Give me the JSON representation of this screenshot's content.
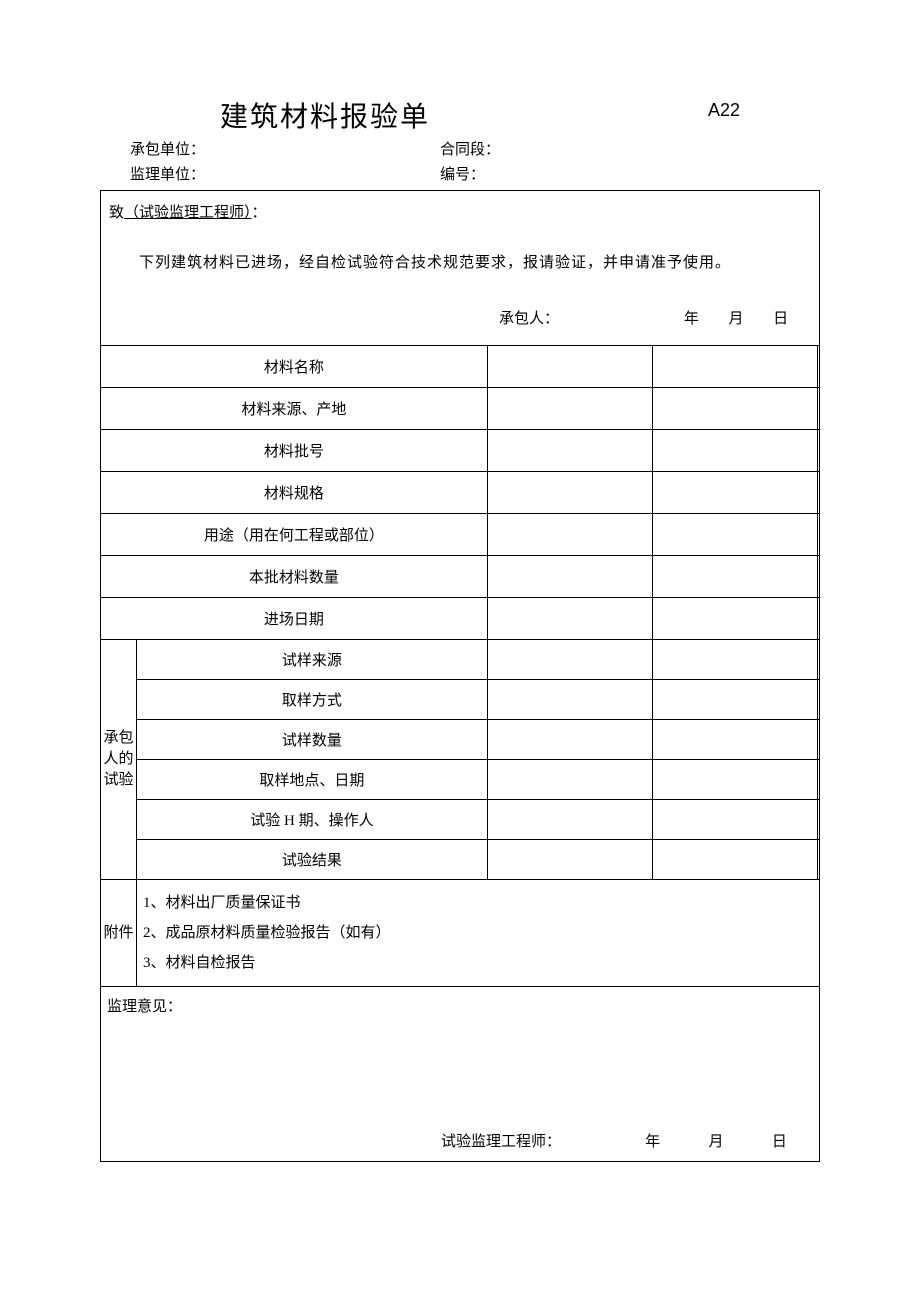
{
  "code": "A22",
  "title": "建筑材料报验单",
  "meta": {
    "contractor_label": "承包单位：",
    "contract_section_label": "合同段：",
    "supervisor_label": "监理单位：",
    "number_label": "编号："
  },
  "top": {
    "to_prefix": "致",
    "to_target": "（试验监理工程师）",
    "to_suffix": "：",
    "body": "下列建筑材料已进场，经自检试验符合技术规范要求，报请验证，并申请准予使用。",
    "person_label": "承包人：",
    "year": "年",
    "month": "月",
    "day": "日"
  },
  "rows": {
    "r1": "材料名称",
    "r2": "材料来源、产地",
    "r3": "材料批号",
    "r4": "材料规格",
    "r5": "用途（用在何工程或部位）",
    "r6": "本批材料数量",
    "r7": "进场日期",
    "group_label": "承包人的试验",
    "g1": "试样来源",
    "g2": "取样方式",
    "g3": "试样数量",
    "g4": "取样地点、日期",
    "g5": "试验 H 期、操作人",
    "g6": "试验结果",
    "attach_label": "附件",
    "attach1": "1、材料出厂质量保证书",
    "attach2": "2、成品原材料质量检验报告（如有）",
    "attach3": "3、材料自检报告",
    "opinion_label": "监理意见：",
    "opinion_person": "试验监理工程师：",
    "year": "年",
    "month": "月",
    "day": "日"
  }
}
